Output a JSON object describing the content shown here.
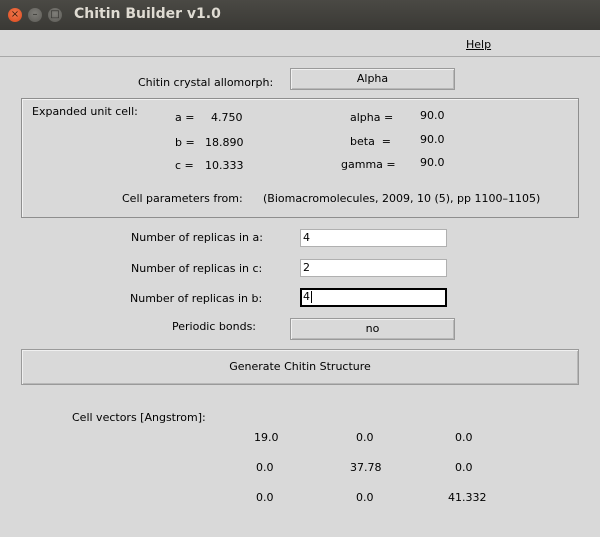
{
  "window": {
    "title": "Chitin Builder v1.0",
    "close_glyph": "×",
    "min_glyph": "–",
    "max_glyph": "□"
  },
  "menu": {
    "help": "Help"
  },
  "allomorph": {
    "label": "Chitin crystal allomorph:",
    "value": "Alpha"
  },
  "unit_cell": {
    "title": "Expanded unit cell:",
    "a_label": "a =",
    "a_value": "4.750",
    "b_label": "b =",
    "b_value": "18.890",
    "c_label": "c =",
    "c_value": "10.333",
    "alpha_label": "alpha =",
    "alpha_value": "90.0",
    "beta_label": "beta  =",
    "beta_value": "90.0",
    "gamma_label": "gamma =",
    "gamma_value": "90.0",
    "source_label": "Cell parameters from:",
    "source_value": "(Biomacromolecules, 2009, 10 (5), pp 1100–1105)"
  },
  "replicas": {
    "a_label": "Number of replicas in a:",
    "a_value": "4",
    "c_label": "Number of replicas in c:",
    "c_value": "2",
    "b_label": "Number of replicas in b:",
    "b_value": "4"
  },
  "periodic": {
    "label": "Periodic bonds:",
    "value": "no"
  },
  "generate_button": "Generate Chitin Structure",
  "cell_vectors": {
    "label": "Cell vectors [Angstrom]:",
    "rows": [
      [
        "19.0",
        "0.0",
        "0.0"
      ],
      [
        "0.0",
        "37.78",
        "0.0"
      ],
      [
        "0.0",
        "0.0",
        "41.332"
      ]
    ]
  }
}
